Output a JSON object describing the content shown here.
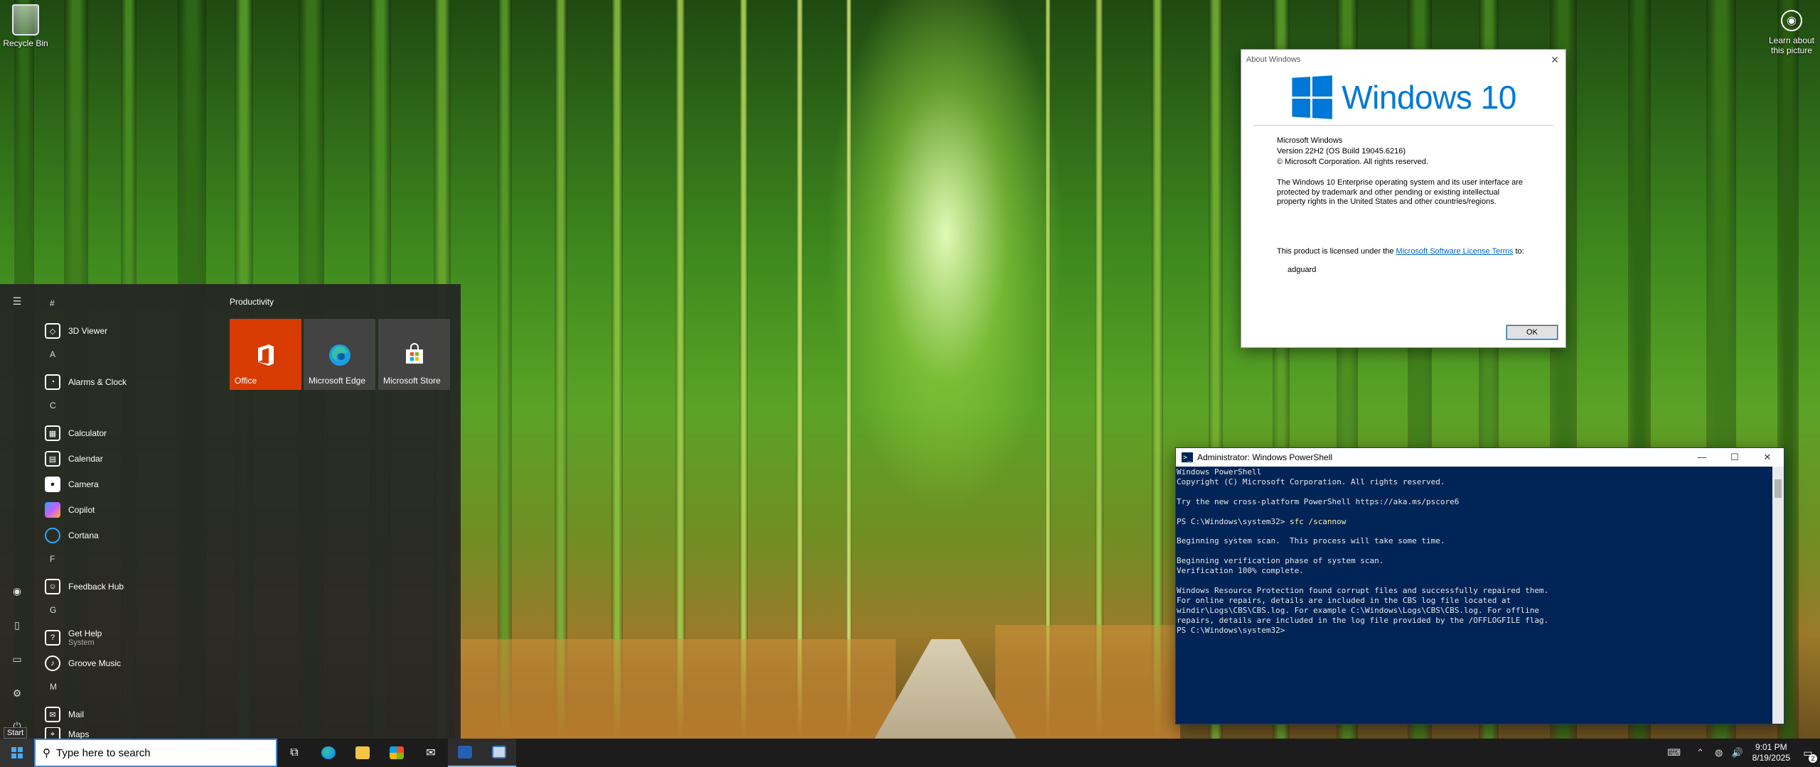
{
  "desktop": {
    "recycle_bin": "Recycle Bin",
    "learn_picture": "Learn about this picture"
  },
  "about": {
    "title": "About Windows",
    "brand": "Windows 10",
    "product": "Microsoft Windows",
    "version": "Version 22H2 (OS Build 19045.6216)",
    "copyright": "© Microsoft Corporation. All rights reserved.",
    "notice": "The Windows 10 Enterprise operating system and its user interface are protected by trademark and other pending or existing intellectual property rights in the United States and other countries/regions.",
    "license_prefix": "This product is licensed under the ",
    "license_link": "Microsoft Software License Terms",
    "license_suffix": " to:",
    "licensee": "adguard",
    "ok": "OK"
  },
  "powershell": {
    "title": "Administrator: Windows PowerShell",
    "lines": [
      {
        "text": "Windows PowerShell"
      },
      {
        "text": "Copyright (C) Microsoft Corporation. All rights reserved."
      },
      {
        "text": ""
      },
      {
        "text": "Try the new cross-platform PowerShell https://aka.ms/pscore6"
      },
      {
        "text": ""
      },
      {
        "prompt": "PS C:\\Windows\\system32> ",
        "cmd": "sfc /scannow"
      },
      {
        "text": ""
      },
      {
        "text": "Beginning system scan.  This process will take some time."
      },
      {
        "text": ""
      },
      {
        "text": "Beginning verification phase of system scan."
      },
      {
        "text": "Verification 100% complete."
      },
      {
        "text": ""
      },
      {
        "text": "Windows Resource Protection found corrupt files and successfully repaired them."
      },
      {
        "text": "For online repairs, details are included in the CBS log file located at"
      },
      {
        "text": "windir\\Logs\\CBS\\CBS.log. For example C:\\Windows\\Logs\\CBS\\CBS.log. For offline"
      },
      {
        "text": "repairs, details are included in the log file provided by the /OFFLOGFILE flag."
      },
      {
        "text": "PS C:\\Windows\\system32>"
      }
    ]
  },
  "start_menu": {
    "letters": {
      "hash": "#",
      "a": "A",
      "c": "C",
      "f": "F",
      "g": "G",
      "m": "M"
    },
    "apps": {
      "viewer3d": "3D Viewer",
      "alarms": "Alarms & Clock",
      "calculator": "Calculator",
      "calendar": "Calendar",
      "camera": "Camera",
      "copilot": "Copilot",
      "cortana": "Cortana",
      "feedback": "Feedback Hub",
      "gethelp": "Get Help",
      "gethelp_sub": "System",
      "groove": "Groove Music",
      "mail": "Mail",
      "maps": "Maps"
    },
    "group": "Productivity",
    "tiles": {
      "office": "Office",
      "edge": "Microsoft Edge",
      "store": "Microsoft Store"
    },
    "tooltip": "Start"
  },
  "taskbar": {
    "search_placeholder": "Type here to search",
    "time": "9:01 PM",
    "date": "8/19/2025",
    "notif_count": "2"
  },
  "colors": {
    "accent": "#0078d7",
    "ps_bg": "#012456",
    "office_tile": "#d83b01"
  }
}
